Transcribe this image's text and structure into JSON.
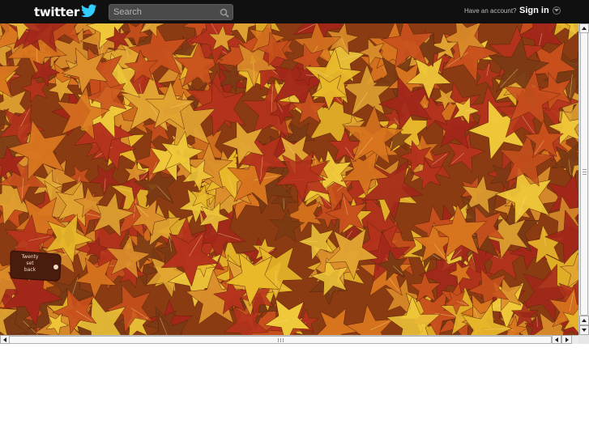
{
  "header": {
    "logo_text": "twitter",
    "search_placeholder": "Search",
    "have_account": "Have an account?",
    "signin_label": "Sign in"
  },
  "background": {
    "tag_line1": "Twenty",
    "tag_line2": "set",
    "tag_line3": "back"
  },
  "colors": {
    "topbar": "#101010",
    "leaf_red": "#b5321c",
    "leaf_orange": "#d9751f",
    "leaf_yellow": "#e9b92a",
    "leaf_brown": "#7a3a14"
  },
  "icons": {
    "logo_bird": "bird-icon",
    "search_button": "magnifier-icon",
    "signin_caret": "chevron-down-icon"
  }
}
